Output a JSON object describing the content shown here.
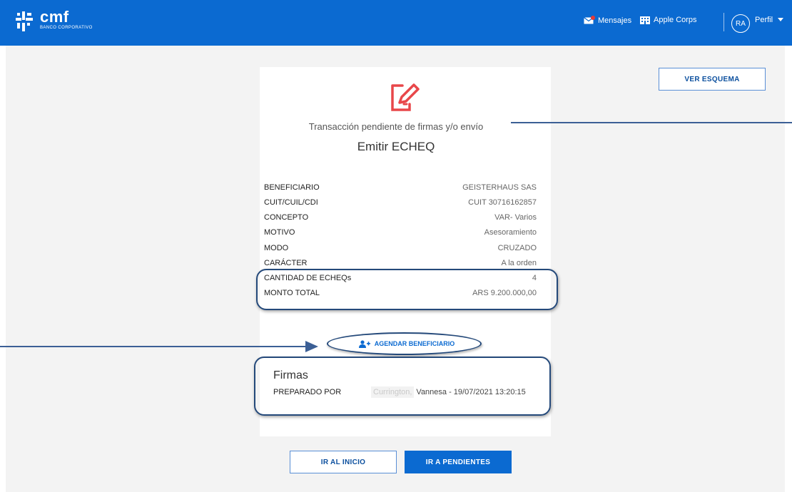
{
  "header": {
    "logo_name": "cmf",
    "logo_sub": "BANCO CORPORATIVO",
    "messages_label": "Mensajes",
    "company_label": "Apple Corps",
    "avatar_initials": "RA",
    "profile_label": "Perfil"
  },
  "actions": {
    "ver_esquema": "VER ESQUEMA",
    "agendar": "AGENDAR BENEFICIARIO",
    "ir_inicio": "IR AL INICIO",
    "ir_pendientes": "IR A PENDIENTES"
  },
  "receipt": {
    "status_title": "Transacción pendiente de firmas y/o envío",
    "operation_title": "Emitir ECHEQ",
    "details": [
      {
        "label": "BENEFICIARIO",
        "value": "GEISTERHAUS SAS"
      },
      {
        "label": "CUIT/CUIL/CDI",
        "value": "CUIT 30716162857"
      },
      {
        "label": "CONCEPTO",
        "value": "VAR- Varios"
      },
      {
        "label": "MOTIVO",
        "value": "Asesoramiento"
      },
      {
        "label": "MODO",
        "value": "CRUZADO"
      },
      {
        "label": "CARÁCTER",
        "value": "A la orden"
      },
      {
        "label": "CANTIDAD DE ECHEQs",
        "value": "4"
      },
      {
        "label": "MONTO TOTAL",
        "value": "ARS 9.200.000,00"
      }
    ],
    "firmas": {
      "title": "Firmas",
      "prepared_label": "PREPARADO POR",
      "prepared_name_blurred": "Currington,",
      "prepared_value": "Vannesa - 19/07/2021 13:20:15"
    }
  },
  "colors": {
    "brand": "#0b6ad1",
    "icon_red": "#e8474a",
    "callout": "#24497a"
  }
}
